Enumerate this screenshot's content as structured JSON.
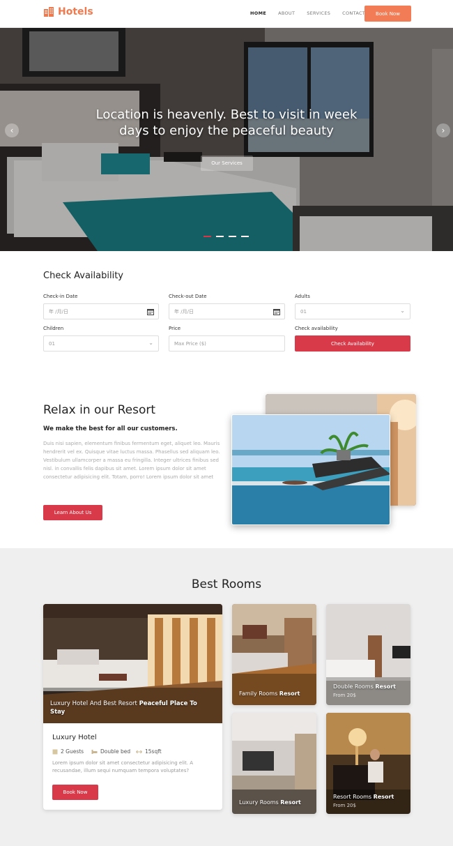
{
  "brand": {
    "name": "Hotels",
    "accent": "#f27c55",
    "primary": "#d83a49"
  },
  "nav": {
    "items": [
      "HOME",
      "ABOUT",
      "SERVICES",
      "CONTACT"
    ],
    "book_label": "Book Now"
  },
  "hero": {
    "title_line1": "Location is heavenly. Best to visit in week",
    "title_line2": "days to enjoy the peaceful beauty",
    "button": "Our Services",
    "slides": 4,
    "active_slide": 1
  },
  "availability": {
    "title": "Check Availability",
    "checkin_label": "Check-in Date",
    "checkin_value": "年 /月/日",
    "checkout_label": "Check-out Date",
    "checkout_value": "年 /月/日",
    "adults_label": "Adults",
    "adults_value": "01",
    "children_label": "Children",
    "children_value": "01",
    "price_label": "Price",
    "price_placeholder": "Max Price ($)",
    "check_label": "Check availability",
    "check_button": "Check Availability"
  },
  "resort": {
    "title": "Relax in our Resort",
    "subtitle": "We make the best for all our customers.",
    "body": "Duis nisi sapien, elementum finibus fermentum eget, aliquet leo. Mauris hendrerit vel ex. Quisque vitae luctus massa. Phasellus sed aliquam leo. Vestibulum ullamcorper a massa eu fringilla. Integer ultrices finibus sed nisl. in convallis felis dapibus sit amet. Lorem ipsum dolor sit amet consectetur adipisicing elit. Totam, porro! Lorem ipsum dolor sit amet",
    "button": "Learn About Us"
  },
  "rooms": {
    "title": "Best Rooms",
    "featured": {
      "caption_plain": "Luxury Hotel And Best Resort ",
      "caption_bold": "Peaceful Place To Stay",
      "name": "Luxury Hotel",
      "guests": "2 Guests",
      "bed": "Double bed",
      "size": "15sqft",
      "desc": "Lorem ipsum dolor sit amet consectetur adipisicing elit. A recusandae, illum sequi numquam tempora voluptates?",
      "button": "Book Now"
    },
    "cards": [
      {
        "plain": "Family Rooms ",
        "bold": "Resort",
        "from": ""
      },
      {
        "plain": "Double Rooms ",
        "bold": "Resort",
        "from": "From 20$"
      },
      {
        "plain": "Luxury Rooms ",
        "bold": "Resort",
        "from": ""
      },
      {
        "plain": "Resort Rooms ",
        "bold": "Resort",
        "from": "From 20$"
      }
    ]
  }
}
